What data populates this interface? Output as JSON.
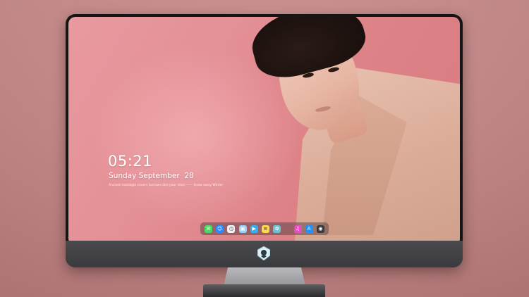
{
  "lockscreen": {
    "time": "05:21",
    "date": "Sunday September  28",
    "quote": "Ancient nostalgia covers Sorrows dim your stars ——  Snow away  Winter"
  },
  "dock": {
    "items": [
      {
        "name": "messages",
        "icon": "message-icon",
        "glyph": "✉",
        "color": "#4cd964"
      },
      {
        "name": "finder",
        "icon": "finder-icon",
        "glyph": "☺",
        "color": "#2f8af5"
      },
      {
        "name": "clock",
        "icon": "clock-icon",
        "glyph": "◷",
        "color": "#f2f2f2"
      },
      {
        "name": "preview",
        "icon": "preview-icon",
        "glyph": "▣",
        "color": "#9ad0f5"
      },
      {
        "name": "final-cut",
        "icon": "clapper-icon",
        "glyph": "▶",
        "color": "#3aaee8"
      },
      {
        "name": "notes",
        "icon": "notes-icon",
        "glyph": "≡",
        "color": "#ffd84a"
      },
      {
        "name": "photos",
        "icon": "photos-icon",
        "glyph": "✿",
        "color": "#6cc3d5"
      },
      {
        "name": "music",
        "icon": "music-icon",
        "glyph": "♫",
        "color": "#e94cc0"
      },
      {
        "name": "app-store",
        "icon": "app-store-icon",
        "glyph": "A",
        "color": "#1e90ff"
      },
      {
        "name": "camera",
        "icon": "camera-icon",
        "glyph": "◉",
        "color": "#3a3a3a"
      }
    ]
  },
  "colors": {
    "wallpaper": "#e38f95",
    "monitor_bezel": "#151515",
    "chin": "#3b3b3f",
    "stand": "#a3a3a8"
  }
}
